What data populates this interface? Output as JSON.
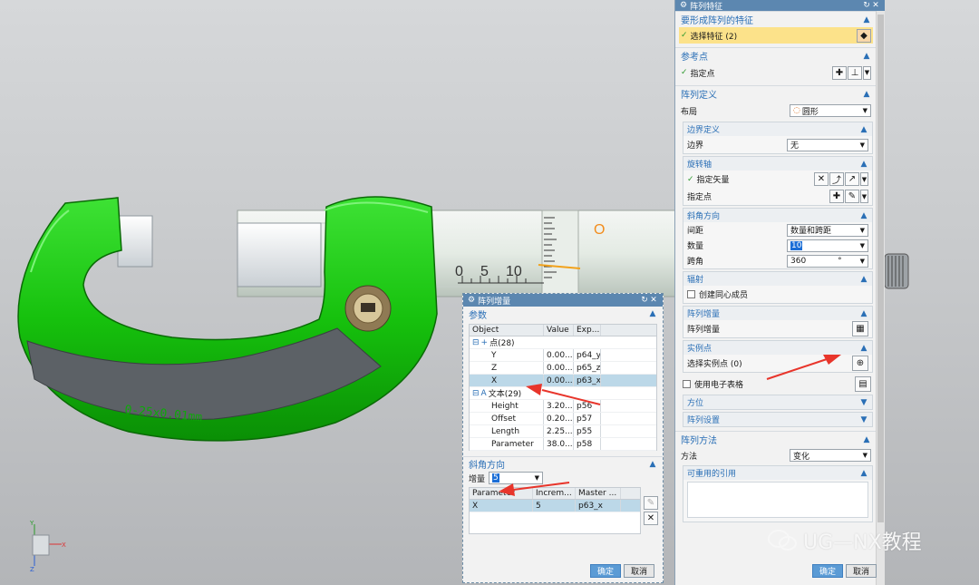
{
  "scene": {
    "scale_text": "0-25x0.01mm",
    "sleeve_numbers": [
      "0",
      "5",
      "10"
    ],
    "thimble_mark": "O",
    "triad": {
      "x": "X",
      "y": "Y",
      "z": "Z"
    }
  },
  "main_panel": {
    "title": "阵列特征",
    "sections": {
      "feature": {
        "title": "要形成阵列的特征",
        "select_label": "选择特征 (2)"
      },
      "ref_point": {
        "title": "参考点",
        "point_label": "指定点"
      },
      "definition": {
        "title": "阵列定义",
        "layout_label": "布局",
        "layout_value": "圆形",
        "boundary": {
          "title": "边界定义",
          "label": "边界",
          "value": "无"
        },
        "axis": {
          "title": "旋转轴",
          "vector_label": "指定矢量",
          "point_label": "指定点"
        },
        "angular": {
          "title": "斜角方向",
          "spacing_label": "间距",
          "spacing_value": "数量和跨距",
          "count_label": "数量",
          "count_value": "10",
          "span_label": "跨角",
          "span_value": "360",
          "span_unit": "°"
        },
        "radial": {
          "title": "辐射",
          "concentric_label": "创建同心成员"
        },
        "increment": {
          "title": "阵列增量",
          "label": "阵列增量"
        },
        "instance": {
          "title": "实例点",
          "label": "选择实例点 (0)"
        },
        "spreadsheet_label": "使用电子表格",
        "orientation_title": "方位",
        "settings_title": "阵列设置"
      },
      "method": {
        "title": "阵列方法",
        "label": "方法",
        "value": "变化",
        "reusable_title": "可重用的引用"
      }
    },
    "ok_label": "确定",
    "cancel_label": "取消"
  },
  "increment_dialog": {
    "title": "阵列增量",
    "params_title": "参数",
    "columns": [
      "Object",
      "Value",
      "Exp..."
    ],
    "rows": [
      {
        "object": "点(28)",
        "value": "",
        "expr": "",
        "group": true,
        "icon": "plus"
      },
      {
        "object": "Y",
        "value": "0.00...",
        "expr": "p64_y"
      },
      {
        "object": "Z",
        "value": "0.00...",
        "expr": "p65_z"
      },
      {
        "object": "X",
        "value": "0.00...",
        "expr": "p63_x",
        "selected": true
      },
      {
        "object": "文本(29)",
        "value": "",
        "expr": "",
        "group": true,
        "icon": "A"
      },
      {
        "object": "Height",
        "value": "3.20...",
        "expr": "p56"
      },
      {
        "object": "Offset",
        "value": "0.20...",
        "expr": "p57"
      },
      {
        "object": "Length",
        "value": "2.25...",
        "expr": "p55"
      },
      {
        "object": "Parameter",
        "value": "38.0...",
        "expr": "p58"
      }
    ],
    "angular_title": "斜角方向",
    "increment_label": "增量",
    "increment_value": "5",
    "inc_columns": [
      "Parameter",
      "Increm...",
      "Master ..."
    ],
    "inc_rows": [
      {
        "parameter": "X",
        "increment": "5",
        "master": "p63_x"
      }
    ],
    "ok_label": "确定",
    "cancel_label": "取消"
  },
  "watermark": "UG—NX教程",
  "colors": {
    "title_bar": "#5c87b0",
    "section": "#2a6fb6",
    "highlight": "#fce28a",
    "frame": "#15c60c",
    "arrow": "#e8352b"
  }
}
